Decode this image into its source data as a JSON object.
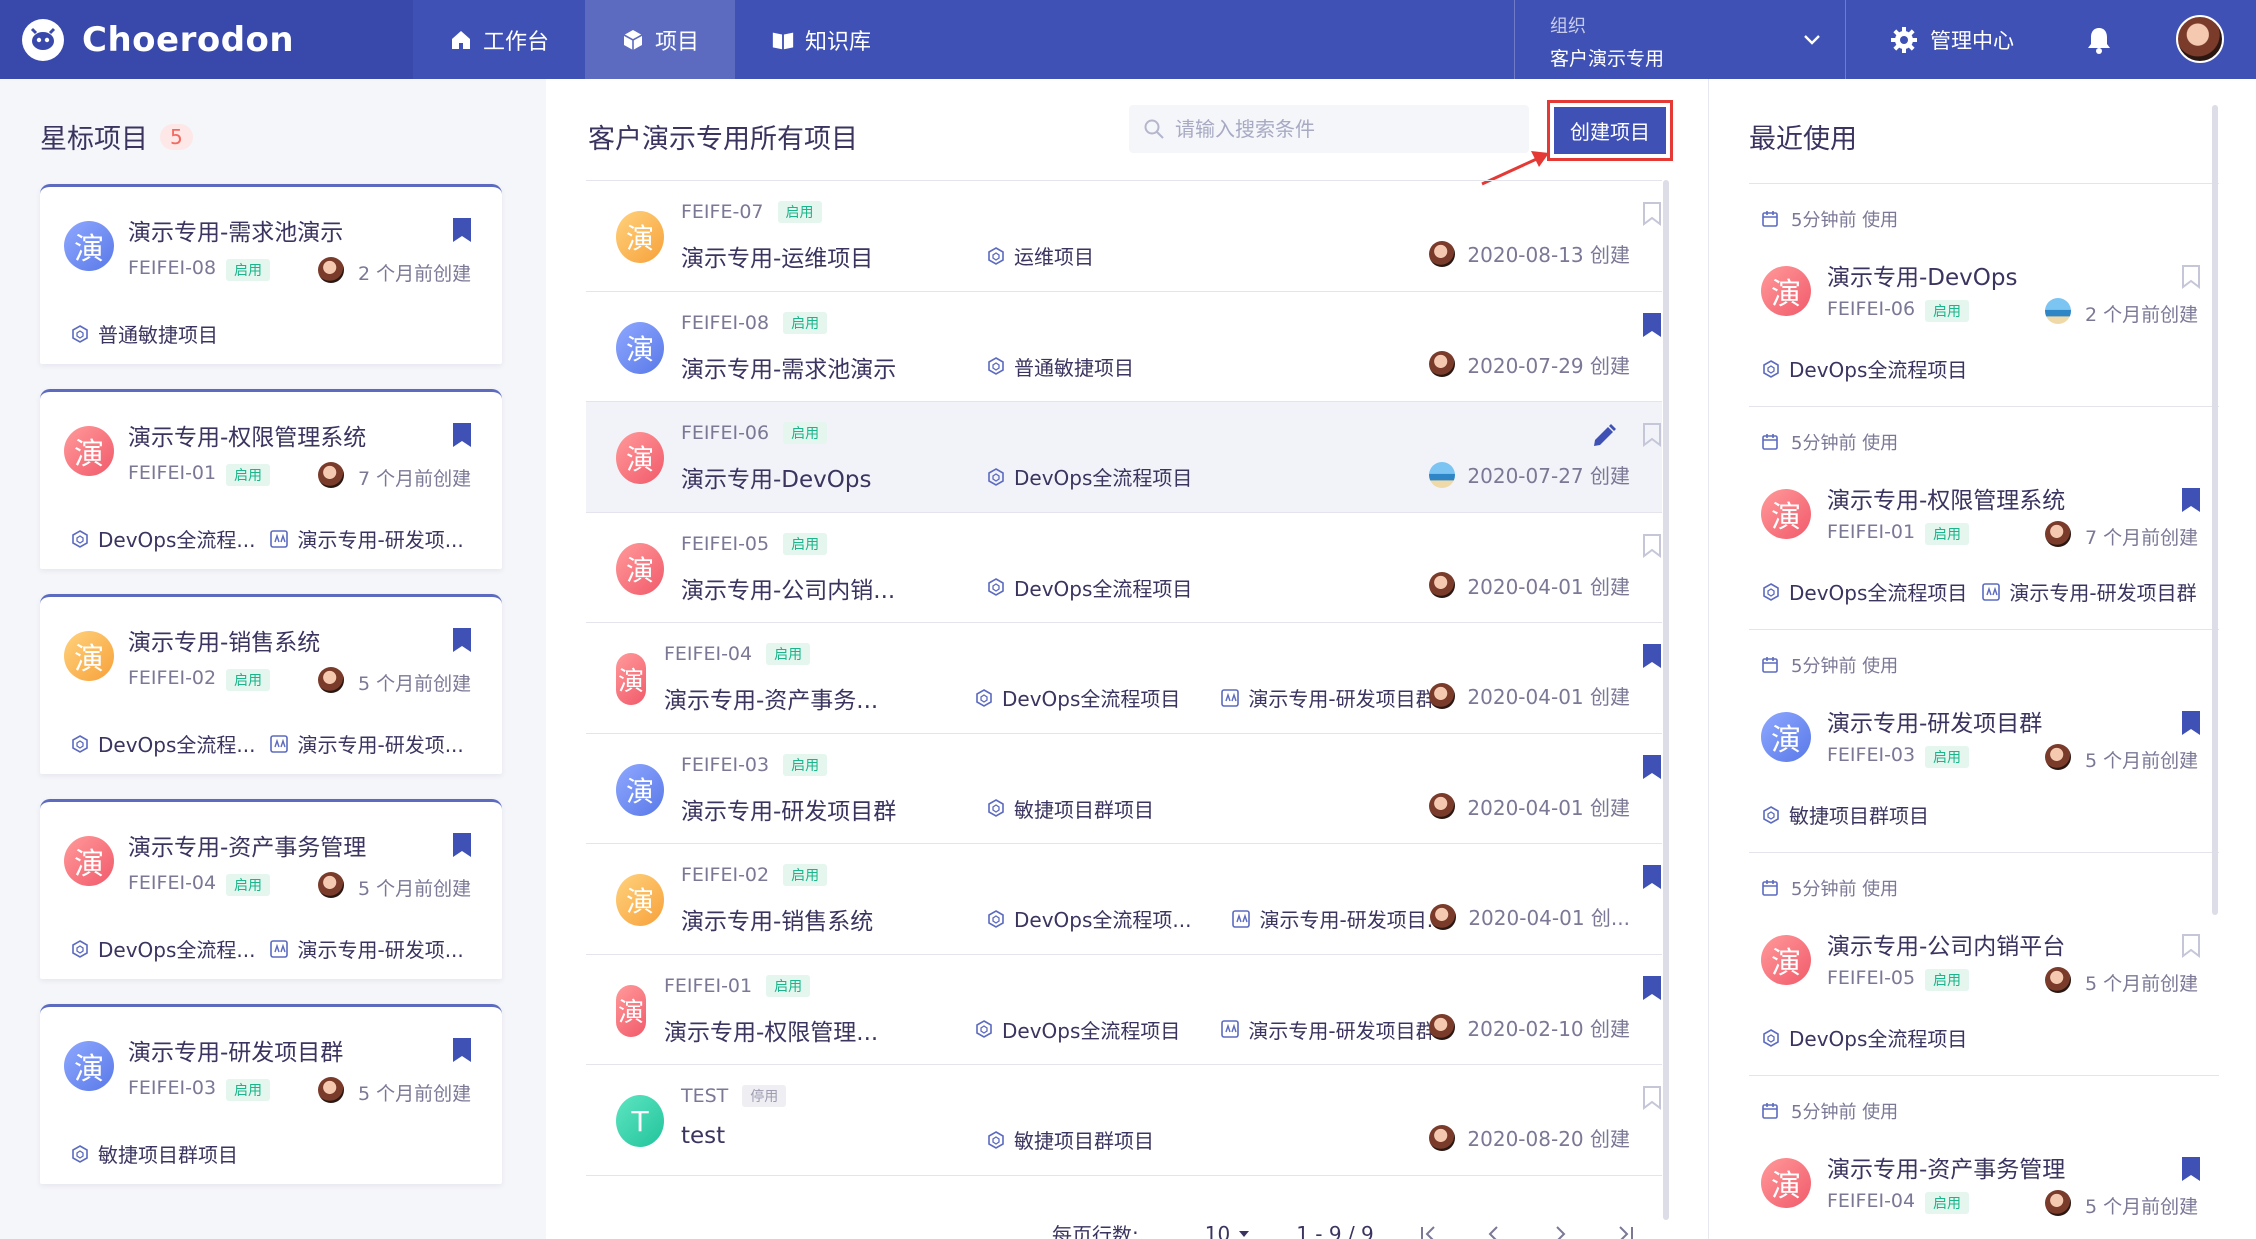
{
  "app": {
    "brand": "Choerodon"
  },
  "nav": {
    "tabs": [
      {
        "label": "工作台",
        "icon": "home-icon"
      },
      {
        "label": "项目",
        "icon": "cube-icon"
      },
      {
        "label": "知识库",
        "icon": "book-icon"
      }
    ],
    "org_label": "组织",
    "org_name": "客户演示专用",
    "admin_label": "管理中心"
  },
  "starred": {
    "title": "星标项目",
    "count": "5",
    "items": [
      {
        "name": "演示专用-需求池演示",
        "code": "FEIFEI-08",
        "status": "启用",
        "created": "2 个月前创建",
        "avatar": "演",
        "tags": [
          "普通敏捷项目"
        ]
      },
      {
        "name": "演示专用-权限管理系统",
        "code": "FEIFEI-01",
        "status": "启用",
        "created": "7 个月前创建",
        "avatar": "演",
        "tags": [
          "DevOps全流程...",
          "演示专用-研发项..."
        ]
      },
      {
        "name": "演示专用-销售系统",
        "code": "FEIFEI-02",
        "status": "启用",
        "created": "5 个月前创建",
        "avatar": "演",
        "tags": [
          "DevOps全流程...",
          "演示专用-研发项..."
        ]
      },
      {
        "name": "演示专用-资产事务管理",
        "code": "FEIFEI-04",
        "status": "启用",
        "created": "5 个月前创建",
        "avatar": "演",
        "tags": [
          "DevOps全流程...",
          "演示专用-研发项..."
        ]
      },
      {
        "name": "演示专用-研发项目群",
        "code": "FEIFEI-03",
        "status": "启用",
        "created": "5 个月前创建",
        "avatar": "演",
        "tags": [
          "敏捷项目群项目"
        ]
      }
    ]
  },
  "all": {
    "title": "客户演示专用所有项目",
    "search_placeholder": "请输入搜索条件",
    "create_label": "创建项目",
    "rows": [
      {
        "code": "FEIFE-07",
        "status": "启用",
        "name": "演示专用-运维项目",
        "avatar": "演",
        "tags": [
          "运维项目"
        ],
        "date": "2020-08-13 创建",
        "starred": false
      },
      {
        "code": "FEIFEI-08",
        "status": "启用",
        "name": "演示专用-需求池演示",
        "avatar": "演",
        "tags": [
          "普通敏捷项目"
        ],
        "date": "2020-07-29 创建",
        "starred": true
      },
      {
        "code": "FEIFEI-06",
        "status": "启用",
        "name": "演示专用-DevOps",
        "avatar": "演",
        "tags": [
          "DevOps全流程项目"
        ],
        "date": "2020-07-27 创建",
        "starred": false
      },
      {
        "code": "FEIFEI-05",
        "status": "启用",
        "name": "演示专用-公司内销...",
        "avatar": "演",
        "tags": [
          "DevOps全流程项目"
        ],
        "date": "2020-04-01 创建",
        "starred": false
      },
      {
        "code": "FEIFEI-04",
        "status": "启用",
        "name": "演示专用-资产事务...",
        "avatar": "演",
        "tags": [
          "DevOps全流程项目",
          "演示专用-研发项目群"
        ],
        "date": "2020-04-01 创建",
        "starred": true
      },
      {
        "code": "FEIFEI-03",
        "status": "启用",
        "name": "演示专用-研发项目群",
        "avatar": "演",
        "tags": [
          "敏捷项目群项目"
        ],
        "date": "2020-04-01 创建",
        "starred": true
      },
      {
        "code": "FEIFEI-02",
        "status": "启用",
        "name": "演示专用-销售系统",
        "avatar": "演",
        "tags": [
          "DevOps全流程项...",
          "演示专用-研发项目..."
        ],
        "date": "2020-04-01 创...",
        "starred": true
      },
      {
        "code": "FEIFEI-01",
        "status": "启用",
        "name": "演示专用-权限管理...",
        "avatar": "演",
        "tags": [
          "DevOps全流程项目",
          "演示专用-研发项目群"
        ],
        "date": "2020-02-10 创建",
        "starred": true
      },
      {
        "code": "TEST",
        "status": "停用",
        "name": "test",
        "avatar": "T",
        "tags": [
          "敏捷项目群项目"
        ],
        "date": "2020-08-20 创建",
        "starred": false
      }
    ],
    "pager": {
      "rows_label": "每页行数:",
      "page_size": "10",
      "range": "1 - 9 / 9"
    }
  },
  "recent": {
    "title": "最近使用",
    "items": [
      {
        "time": "5分钟前 使用",
        "name": "演示专用-DevOps",
        "code": "FEIFEI-06",
        "status": "启用",
        "created": "2 个月前创建",
        "avatar": "演",
        "tags": [
          "DevOps全流程项目"
        ],
        "starred": false
      },
      {
        "time": "5分钟前 使用",
        "name": "演示专用-权限管理系统",
        "code": "FEIFEI-01",
        "status": "启用",
        "created": "7 个月前创建",
        "avatar": "演",
        "tags": [
          "DevOps全流程项目",
          "演示专用-研发项目群"
        ],
        "starred": true
      },
      {
        "time": "5分钟前 使用",
        "name": "演示专用-研发项目群",
        "code": "FEIFEI-03",
        "status": "启用",
        "created": "5 个月前创建",
        "avatar": "演",
        "tags": [
          "敏捷项目群项目"
        ],
        "starred": true
      },
      {
        "time": "5分钟前 使用",
        "name": "演示专用-公司内销平台",
        "code": "FEIFEI-05",
        "status": "启用",
        "created": "5 个月前创建",
        "avatar": "演",
        "tags": [
          "DevOps全流程项目"
        ],
        "starred": false
      },
      {
        "time": "5分钟前 使用",
        "name": "演示专用-资产事务管理",
        "code": "FEIFEI-04",
        "status": "启用",
        "created": "5 个月前创建",
        "avatar": "演",
        "tags": [],
        "starred": true
      }
    ]
  },
  "colors": {
    "primary": "#3f51b5",
    "accent": "#5c6bc0",
    "enabled": "#1ab58a",
    "highlight": "#e53935"
  }
}
